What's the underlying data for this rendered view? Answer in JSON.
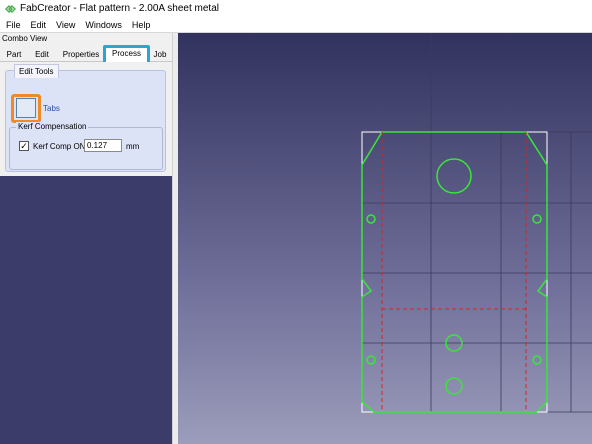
{
  "window": {
    "app_icon": "fabcreator-logo-icon",
    "title": "FabCreator - Flat pattern - 2.00A sheet metal"
  },
  "menubar": {
    "items": [
      "File",
      "Edit",
      "View",
      "Windows",
      "Help"
    ]
  },
  "combo_view": {
    "header": "Combo View",
    "tabs": [
      {
        "label": "Part"
      },
      {
        "label": "Edit"
      },
      {
        "label": "Properties"
      },
      {
        "label": "Process",
        "active": true
      },
      {
        "label": "Job"
      }
    ],
    "edit_tools": {
      "title": "Edit Tools",
      "tabs_button_label": "Tabs",
      "tabs_icon": "tabs-tool-icon"
    },
    "kerf": {
      "title": "Kerf Compensation",
      "checkbox_checked": true,
      "checkbox_label": "Kerf Comp ON",
      "value": "0.127",
      "unit": "mm"
    }
  },
  "colors": {
    "highlight_tab": "#2aa6d6",
    "highlight_tool": "#f08a24",
    "cut_line": "#39e639",
    "bend_line": "#e02020"
  }
}
